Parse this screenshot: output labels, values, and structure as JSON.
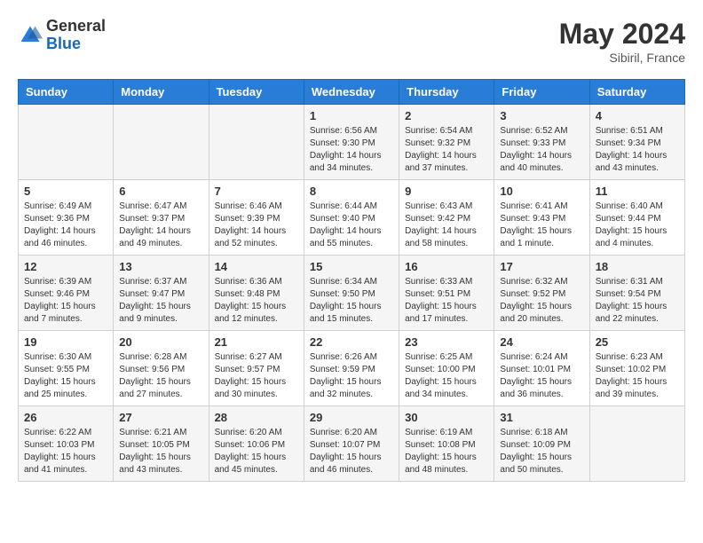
{
  "header": {
    "logo_general": "General",
    "logo_blue": "Blue",
    "month_title": "May 2024",
    "subtitle": "Sibiril, France"
  },
  "days_of_week": [
    "Sunday",
    "Monday",
    "Tuesday",
    "Wednesday",
    "Thursday",
    "Friday",
    "Saturday"
  ],
  "weeks": [
    [
      {
        "day": "",
        "sunrise": "",
        "sunset": "",
        "daylight": ""
      },
      {
        "day": "",
        "sunrise": "",
        "sunset": "",
        "daylight": ""
      },
      {
        "day": "",
        "sunrise": "",
        "sunset": "",
        "daylight": ""
      },
      {
        "day": "1",
        "sunrise": "Sunrise: 6:56 AM",
        "sunset": "Sunset: 9:30 PM",
        "daylight": "Daylight: 14 hours and 34 minutes."
      },
      {
        "day": "2",
        "sunrise": "Sunrise: 6:54 AM",
        "sunset": "Sunset: 9:32 PM",
        "daylight": "Daylight: 14 hours and 37 minutes."
      },
      {
        "day": "3",
        "sunrise": "Sunrise: 6:52 AM",
        "sunset": "Sunset: 9:33 PM",
        "daylight": "Daylight: 14 hours and 40 minutes."
      },
      {
        "day": "4",
        "sunrise": "Sunrise: 6:51 AM",
        "sunset": "Sunset: 9:34 PM",
        "daylight": "Daylight: 14 hours and 43 minutes."
      }
    ],
    [
      {
        "day": "5",
        "sunrise": "Sunrise: 6:49 AM",
        "sunset": "Sunset: 9:36 PM",
        "daylight": "Daylight: 14 hours and 46 minutes."
      },
      {
        "day": "6",
        "sunrise": "Sunrise: 6:47 AM",
        "sunset": "Sunset: 9:37 PM",
        "daylight": "Daylight: 14 hours and 49 minutes."
      },
      {
        "day": "7",
        "sunrise": "Sunrise: 6:46 AM",
        "sunset": "Sunset: 9:39 PM",
        "daylight": "Daylight: 14 hours and 52 minutes."
      },
      {
        "day": "8",
        "sunrise": "Sunrise: 6:44 AM",
        "sunset": "Sunset: 9:40 PM",
        "daylight": "Daylight: 14 hours and 55 minutes."
      },
      {
        "day": "9",
        "sunrise": "Sunrise: 6:43 AM",
        "sunset": "Sunset: 9:42 PM",
        "daylight": "Daylight: 14 hours and 58 minutes."
      },
      {
        "day": "10",
        "sunrise": "Sunrise: 6:41 AM",
        "sunset": "Sunset: 9:43 PM",
        "daylight": "Daylight: 15 hours and 1 minute."
      },
      {
        "day": "11",
        "sunrise": "Sunrise: 6:40 AM",
        "sunset": "Sunset: 9:44 PM",
        "daylight": "Daylight: 15 hours and 4 minutes."
      }
    ],
    [
      {
        "day": "12",
        "sunrise": "Sunrise: 6:39 AM",
        "sunset": "Sunset: 9:46 PM",
        "daylight": "Daylight: 15 hours and 7 minutes."
      },
      {
        "day": "13",
        "sunrise": "Sunrise: 6:37 AM",
        "sunset": "Sunset: 9:47 PM",
        "daylight": "Daylight: 15 hours and 9 minutes."
      },
      {
        "day": "14",
        "sunrise": "Sunrise: 6:36 AM",
        "sunset": "Sunset: 9:48 PM",
        "daylight": "Daylight: 15 hours and 12 minutes."
      },
      {
        "day": "15",
        "sunrise": "Sunrise: 6:34 AM",
        "sunset": "Sunset: 9:50 PM",
        "daylight": "Daylight: 15 hours and 15 minutes."
      },
      {
        "day": "16",
        "sunrise": "Sunrise: 6:33 AM",
        "sunset": "Sunset: 9:51 PM",
        "daylight": "Daylight: 15 hours and 17 minutes."
      },
      {
        "day": "17",
        "sunrise": "Sunrise: 6:32 AM",
        "sunset": "Sunset: 9:52 PM",
        "daylight": "Daylight: 15 hours and 20 minutes."
      },
      {
        "day": "18",
        "sunrise": "Sunrise: 6:31 AM",
        "sunset": "Sunset: 9:54 PM",
        "daylight": "Daylight: 15 hours and 22 minutes."
      }
    ],
    [
      {
        "day": "19",
        "sunrise": "Sunrise: 6:30 AM",
        "sunset": "Sunset: 9:55 PM",
        "daylight": "Daylight: 15 hours and 25 minutes."
      },
      {
        "day": "20",
        "sunrise": "Sunrise: 6:28 AM",
        "sunset": "Sunset: 9:56 PM",
        "daylight": "Daylight: 15 hours and 27 minutes."
      },
      {
        "day": "21",
        "sunrise": "Sunrise: 6:27 AM",
        "sunset": "Sunset: 9:57 PM",
        "daylight": "Daylight: 15 hours and 30 minutes."
      },
      {
        "day": "22",
        "sunrise": "Sunrise: 6:26 AM",
        "sunset": "Sunset: 9:59 PM",
        "daylight": "Daylight: 15 hours and 32 minutes."
      },
      {
        "day": "23",
        "sunrise": "Sunrise: 6:25 AM",
        "sunset": "Sunset: 10:00 PM",
        "daylight": "Daylight: 15 hours and 34 minutes."
      },
      {
        "day": "24",
        "sunrise": "Sunrise: 6:24 AM",
        "sunset": "Sunset: 10:01 PM",
        "daylight": "Daylight: 15 hours and 36 minutes."
      },
      {
        "day": "25",
        "sunrise": "Sunrise: 6:23 AM",
        "sunset": "Sunset: 10:02 PM",
        "daylight": "Daylight: 15 hours and 39 minutes."
      }
    ],
    [
      {
        "day": "26",
        "sunrise": "Sunrise: 6:22 AM",
        "sunset": "Sunset: 10:03 PM",
        "daylight": "Daylight: 15 hours and 41 minutes."
      },
      {
        "day": "27",
        "sunrise": "Sunrise: 6:21 AM",
        "sunset": "Sunset: 10:05 PM",
        "daylight": "Daylight: 15 hours and 43 minutes."
      },
      {
        "day": "28",
        "sunrise": "Sunrise: 6:20 AM",
        "sunset": "Sunset: 10:06 PM",
        "daylight": "Daylight: 15 hours and 45 minutes."
      },
      {
        "day": "29",
        "sunrise": "Sunrise: 6:20 AM",
        "sunset": "Sunset: 10:07 PM",
        "daylight": "Daylight: 15 hours and 46 minutes."
      },
      {
        "day": "30",
        "sunrise": "Sunrise: 6:19 AM",
        "sunset": "Sunset: 10:08 PM",
        "daylight": "Daylight: 15 hours and 48 minutes."
      },
      {
        "day": "31",
        "sunrise": "Sunrise: 6:18 AM",
        "sunset": "Sunset: 10:09 PM",
        "daylight": "Daylight: 15 hours and 50 minutes."
      },
      {
        "day": "",
        "sunrise": "",
        "sunset": "",
        "daylight": ""
      }
    ]
  ]
}
